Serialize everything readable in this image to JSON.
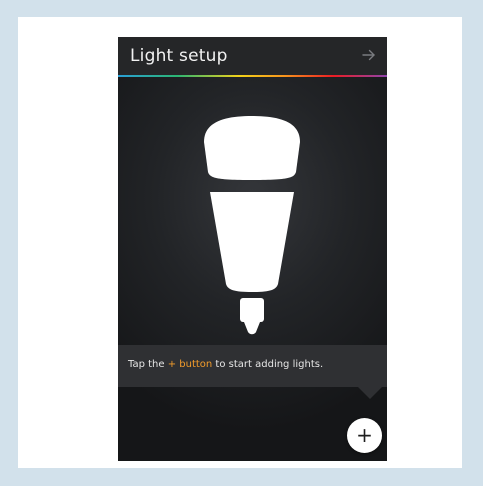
{
  "colors": {
    "backdrop": "#d2e1eb",
    "panel": "#ffffff",
    "screen": "#1c1d20",
    "accent": "#f39c2b",
    "bulb": "#ffffff"
  },
  "header": {
    "title": "Light setup",
    "next_icon": "arrow-right-icon"
  },
  "illustration": {
    "icon": "light-bulb-icon"
  },
  "hint": {
    "prefix": "Tap the ",
    "accent": "+ button",
    "suffix": " to start adding lights."
  },
  "add_button": {
    "label": "+",
    "icon": "plus-icon"
  }
}
